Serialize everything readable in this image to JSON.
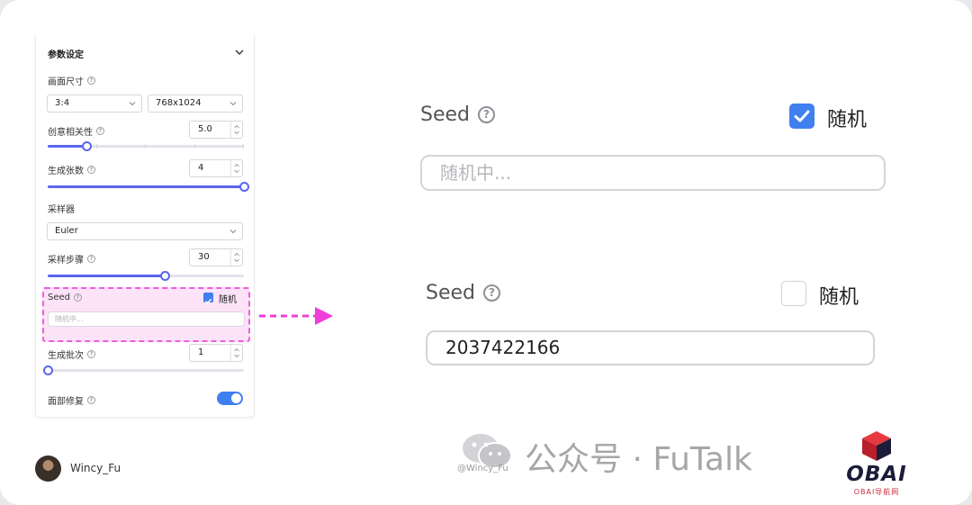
{
  "panel": {
    "title": "参数设定",
    "size_label": "画面尺寸",
    "ratio_value": "3:4",
    "resolution_value": "768x1024",
    "creativity_label": "创意相关性",
    "creativity_value": "5.0",
    "count_label": "生成张数",
    "count_value": "4",
    "sampler_label": "采样器",
    "sampler_value": "Euler",
    "steps_label": "采样步骤",
    "steps_value": "30",
    "seed_label": "Seed",
    "random_label": "随机",
    "seed_placeholder": "随机中...",
    "batch_label": "生成批次",
    "batch_value": "1",
    "face_fix_label": "面部修复",
    "sliders": {
      "creativity_fraction": 0.2,
      "count_fraction": 1.0,
      "steps_fraction": 0.6,
      "batch_fraction": 0.0
    },
    "face_fix_on": true
  },
  "zoom_random": {
    "seed_label": "Seed",
    "random_label": "随机",
    "random_checked": true,
    "placeholder": "随机中..."
  },
  "zoom_fixed": {
    "seed_label": "Seed",
    "random_label": "随机",
    "random_checked": false,
    "value": "2037422166"
  },
  "footer": {
    "author": "Wincy_Fu",
    "watermark_handle": "@Wincy_Fu",
    "watermark_text": "公众号 · FuTalk",
    "logo_text": "OBAI",
    "logo_sub": "OBAI导航网"
  },
  "colors": {
    "accent": "#3f7ff0",
    "slider": "#5b66f0",
    "highlight_border": "#ef5ce0",
    "highlight_fill": "#fde3f8",
    "arrow": "#f03cd8"
  }
}
